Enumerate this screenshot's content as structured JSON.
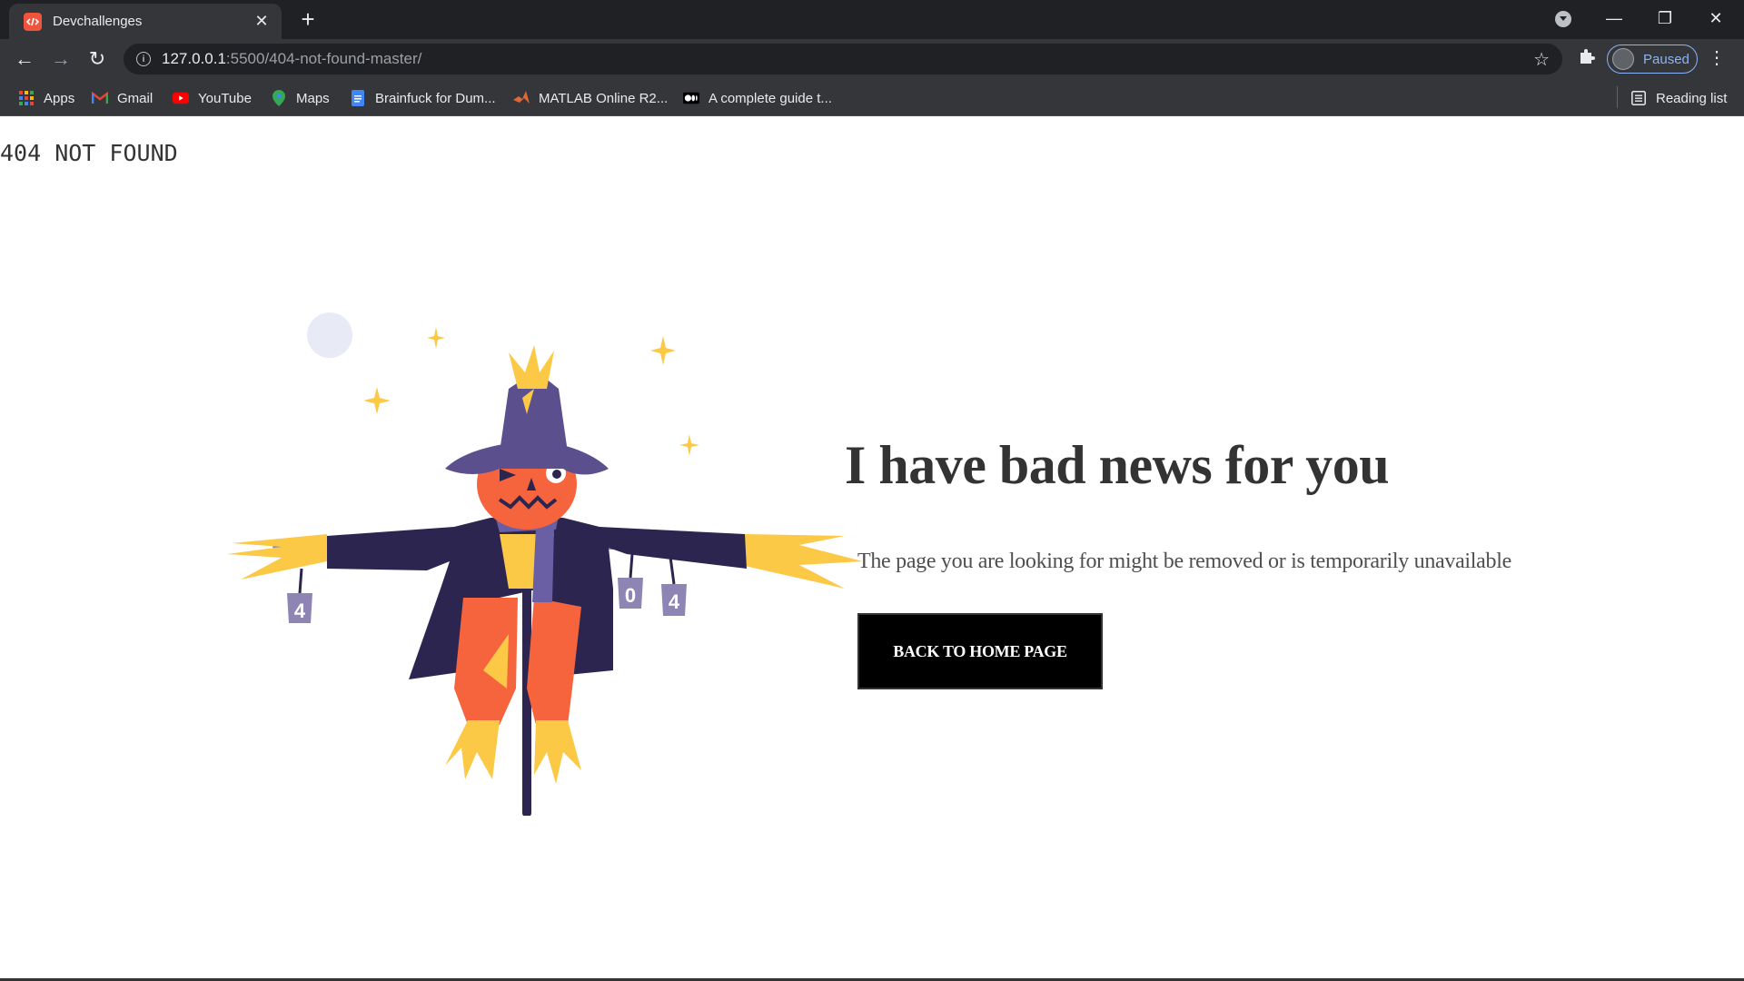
{
  "browser": {
    "tab": {
      "title": "Devchallenges",
      "close_glyph": "✕"
    },
    "new_tab_glyph": "+",
    "window": {
      "minimize": "—",
      "maximize": "❐",
      "close": "✕"
    },
    "nav": {
      "back": "←",
      "forward": "→",
      "reload": "↻"
    },
    "url": {
      "host": "127.0.0.1",
      "rest": ":5500/404-not-found-master/"
    },
    "star_glyph": "☆",
    "extensions_glyph": "✚",
    "profile": {
      "label": "Paused"
    },
    "menu_glyph": "⋮",
    "bookmarks": [
      {
        "label": "Apps",
        "icon": "apps-grid-icon",
        "color": "#ea4335"
      },
      {
        "label": "Gmail",
        "icon": "gmail-icon",
        "color": "#ea4335"
      },
      {
        "label": "YouTube",
        "icon": "youtube-icon",
        "color": "#ff0000"
      },
      {
        "label": "Maps",
        "icon": "maps-pin-icon",
        "color": "#34a853"
      },
      {
        "label": "Brainfuck for Dum...",
        "icon": "docs-icon",
        "color": "#4285f4"
      },
      {
        "label": "MATLAB Online R2...",
        "icon": "matlab-icon",
        "color": "#e16737"
      },
      {
        "label": "A complete guide t...",
        "icon": "medium-icon",
        "color": "#ffffff"
      }
    ],
    "reading_list": {
      "label": "Reading list",
      "icon": "reading-list-icon"
    }
  },
  "page": {
    "logo": "404 NOT FOUND",
    "headline": "I have bad news for you",
    "subtext": "The page you are looking for might be removed or is temporarily unavailable",
    "button_label": "BACK TO HOME PAGE",
    "illustration": {
      "name": "scarecrow-illustration",
      "cans": [
        "4",
        "0",
        "4"
      ],
      "colors": {
        "hat": "#5b4f8e",
        "coat": "#2c2550",
        "pumpkin": "#f5643c",
        "pants": "#f5643c",
        "straw": "#fcc947",
        "scarf": "#6a5ea4",
        "cans": "#8f85b4",
        "moon": "#e8eaf5",
        "sparkle": "#fcc947"
      }
    }
  },
  "colors": {
    "accent_text": "#333333",
    "subtext": "#4f4f4f",
    "button_bg": "#000000",
    "chrome_dark": "#202124",
    "chrome_toolbar": "#35363a"
  }
}
